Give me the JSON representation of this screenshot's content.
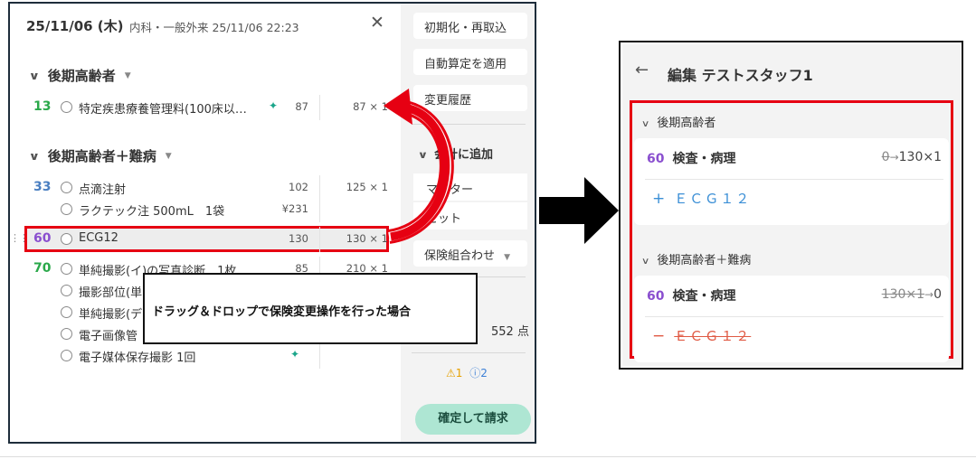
{
  "header": {
    "date": "25/11/06 (木)",
    "visit_info": "内科・一般外来 25/11/06 22:23",
    "close_icon": "close-icon"
  },
  "groups": [
    {
      "label": "後期高齢者",
      "rows": [
        {
          "num": "13",
          "name": "特定疾患療養管理料(100床以…",
          "points": "87",
          "qty": "87 × 1",
          "ai": true
        }
      ]
    },
    {
      "label": "後期高齢者＋難病",
      "rows": [
        {
          "num": "33",
          "name": "点滴注射",
          "points": "102",
          "qty": "125 × 1"
        },
        {
          "num": "",
          "name": "ラクテック注 500mL　1袋",
          "points": "¥231",
          "qty": ""
        },
        {
          "num": "60",
          "name": "ECG12",
          "points": "130",
          "qty": "130 × 1"
        },
        {
          "num": "70",
          "name": "単純撮影(イ)の写真診断　1枚",
          "points": "85",
          "qty": "210 × 1"
        },
        {
          "num": "",
          "name": "撮影部位(単",
          "points": "",
          "qty": ""
        },
        {
          "num": "",
          "name": "単純撮影(デ",
          "points": "",
          "qty": ""
        },
        {
          "num": "",
          "name": "電子画像管",
          "points": "",
          "qty": ""
        },
        {
          "num": "",
          "name": "電子媒体保存撮影 1回",
          "points": "",
          "qty": "",
          "ai": true
        }
      ]
    }
  ],
  "side": {
    "reset_label": "初期化・再取込",
    "auto_label": "自動算定を適用",
    "history_label": "変更履歴",
    "add_section": "会計に追加",
    "master_label": "マスター",
    "set_label": "セット",
    "insurance_label": "保険組合わせ",
    "total": "552 点",
    "warn_count": "1",
    "info_count": "2",
    "confirm_label": "確定して請求"
  },
  "note": {
    "text": "ドラッグ＆ドロップで保険変更操作を行った場合"
  },
  "right": {
    "title": "編集  テストスタッフ1",
    "groups": [
      {
        "label": "後期高齢者",
        "item_num": "60",
        "item_name": "検査・病理",
        "old_value": "0",
        "new_value": "130×1",
        "change_label": "ＥＣＧ１２"
      },
      {
        "label": "後期高齢者＋難病",
        "item_num": "60",
        "item_name": "検査・病理",
        "old_value": "130×1",
        "new_value": "0",
        "change_label": "ＥＣＧ１２"
      }
    ]
  },
  "colors": {
    "highlight": "#e60012",
    "accent_green": "#2aa84a",
    "accent_blue": "#4a7fc1",
    "accent_purple": "#8a4fcf",
    "confirm_bg": "#aee6d3"
  }
}
